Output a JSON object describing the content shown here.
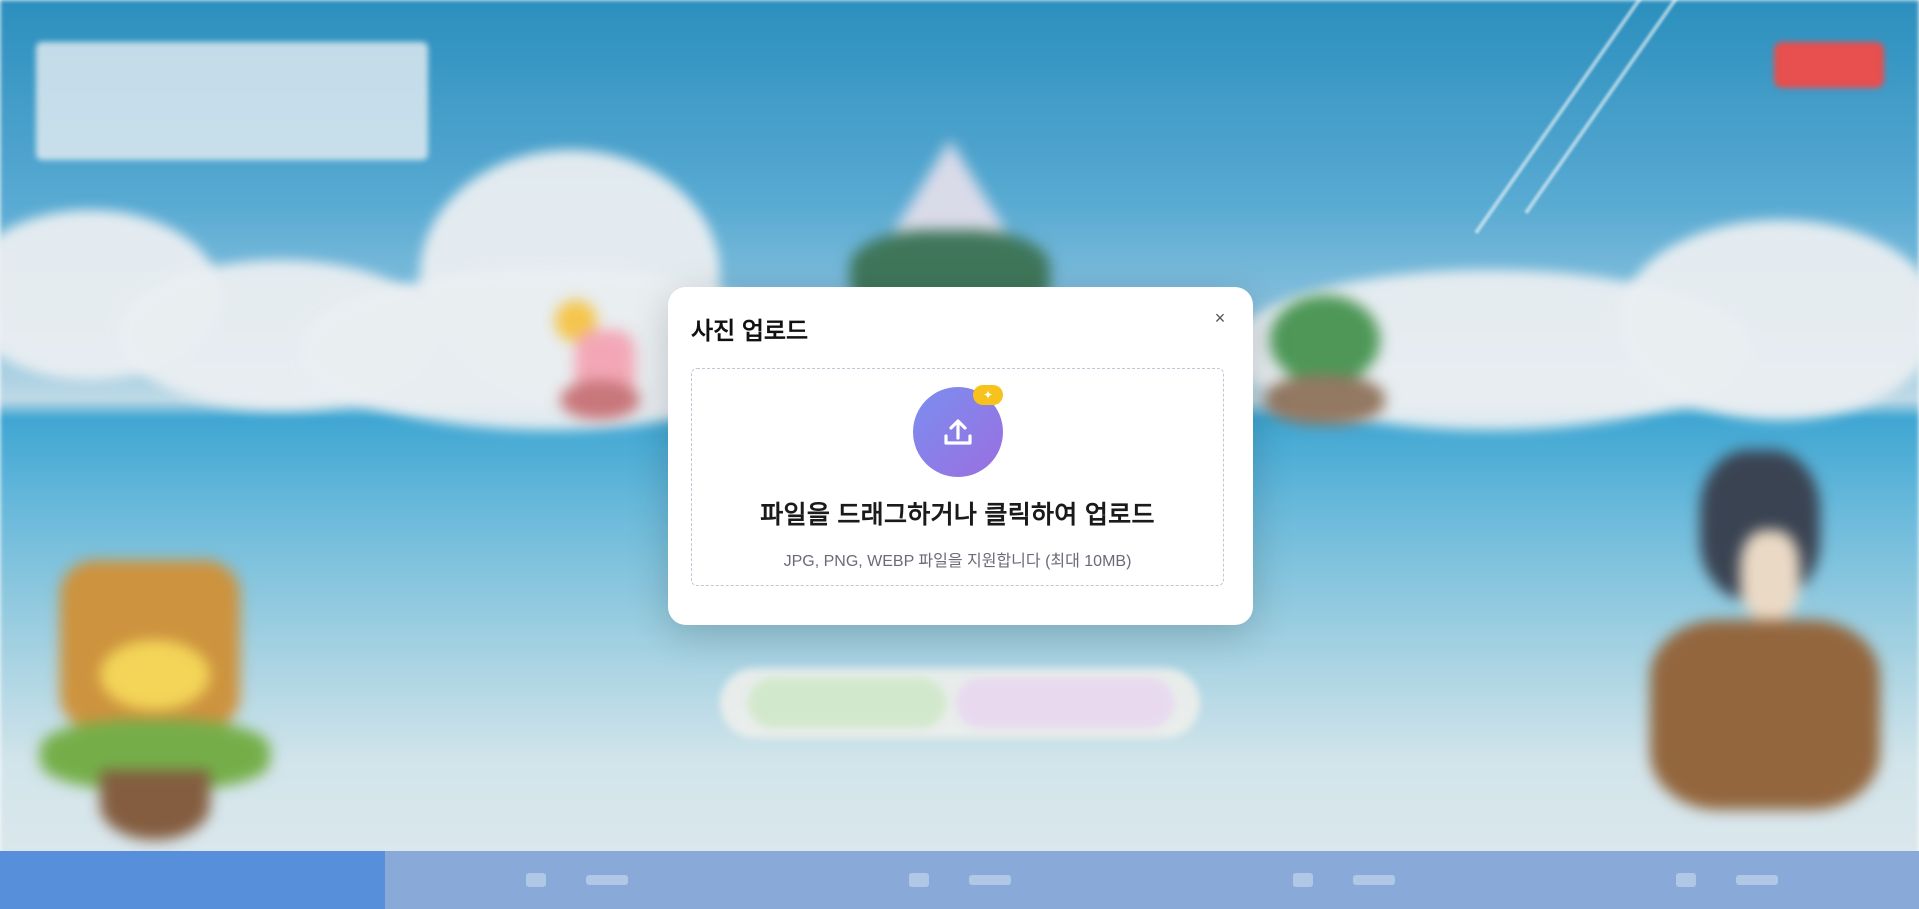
{
  "modal": {
    "title": "사진 업로드",
    "close_label": "×",
    "dropzone": {
      "title": "파일을 드래그하거나 클릭하여 업로드",
      "subtitle": "JPG, PNG, WEBP 파일을 지원합니다 (최대 10MB)",
      "upload_icon": "upload-icon",
      "badge_icon": "sparkle-icon"
    }
  },
  "colors": {
    "upload_gradient_start": "#7b8ef0",
    "upload_gradient_end": "#9a6fe0",
    "badge": "#f7c21b",
    "top_button": "#e64040",
    "nav_active": "#4a86d8",
    "nav_bar": "#7fa3d6"
  }
}
